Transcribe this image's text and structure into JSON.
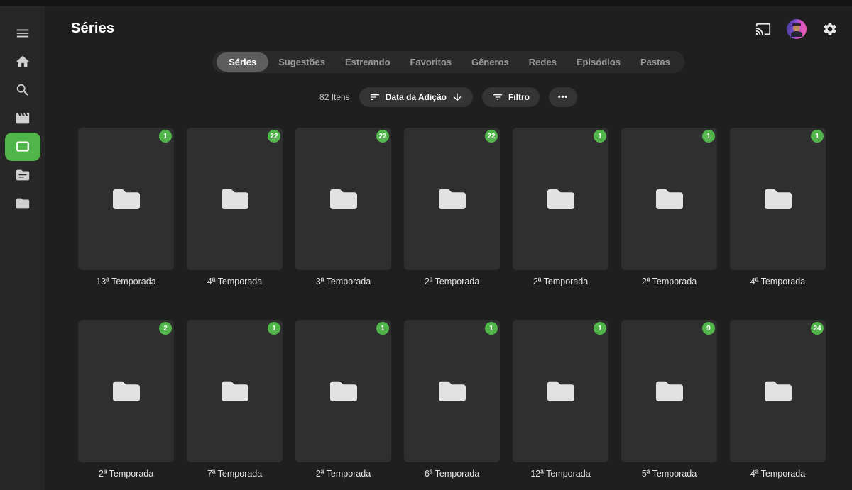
{
  "colors": {
    "accent": "#52b54b",
    "badge": "#52b54b",
    "page_bg": "#1f1f1f",
    "sidebar_bg": "#272727",
    "card_bg": "#2f2f2f"
  },
  "sidebar": {
    "items": [
      {
        "name": "menu",
        "icon": "menu-icon",
        "active": false
      },
      {
        "name": "home",
        "icon": "home-icon",
        "active": false
      },
      {
        "name": "search",
        "icon": "search-icon",
        "active": false
      },
      {
        "name": "movies",
        "icon": "movie-icon",
        "active": false
      },
      {
        "name": "series",
        "icon": "tv-icon",
        "active": true
      },
      {
        "name": "library",
        "icon": "folder-lines-icon",
        "active": false
      },
      {
        "name": "folders",
        "icon": "folder-icon",
        "active": false
      }
    ]
  },
  "header": {
    "title": "Séries",
    "icons": [
      "cast-icon",
      "avatar",
      "settings-icon"
    ]
  },
  "tabs": {
    "items": [
      {
        "label": "Séries",
        "active": true
      },
      {
        "label": "Sugestões",
        "active": false
      },
      {
        "label": "Estreando",
        "active": false
      },
      {
        "label": "Favoritos",
        "active": false
      },
      {
        "label": "Gêneros",
        "active": false
      },
      {
        "label": "Redes",
        "active": false
      },
      {
        "label": "Episódios",
        "active": false
      },
      {
        "label": "Pastas",
        "active": false
      }
    ]
  },
  "toolbar": {
    "item_count": "82 Itens",
    "sort_label": "Data da Adição",
    "sort_icon": "sort-icon",
    "sort_direction_icon": "arrow-down-icon",
    "filter_label": "Filtro",
    "filter_icon": "filter-icon",
    "more_label": "•••"
  },
  "library": {
    "folders": [
      {
        "label": "13ª Temporada",
        "count": "1"
      },
      {
        "label": "4ª Temporada",
        "count": "22"
      },
      {
        "label": "3ª Temporada",
        "count": "22"
      },
      {
        "label": "2ª Temporada",
        "count": "22"
      },
      {
        "label": "2ª Temporada",
        "count": "1"
      },
      {
        "label": "2ª Temporada",
        "count": "1"
      },
      {
        "label": "4ª Temporada",
        "count": "1"
      },
      {
        "label": "2ª Temporada",
        "count": "2"
      },
      {
        "label": "7ª Temporada",
        "count": "1"
      },
      {
        "label": "2ª Temporada",
        "count": "1"
      },
      {
        "label": "6ª Temporada",
        "count": "1"
      },
      {
        "label": "12ª Temporada",
        "count": "1"
      },
      {
        "label": "5ª Temporada",
        "count": "9"
      },
      {
        "label": "4ª Temporada",
        "count": "24"
      }
    ]
  }
}
